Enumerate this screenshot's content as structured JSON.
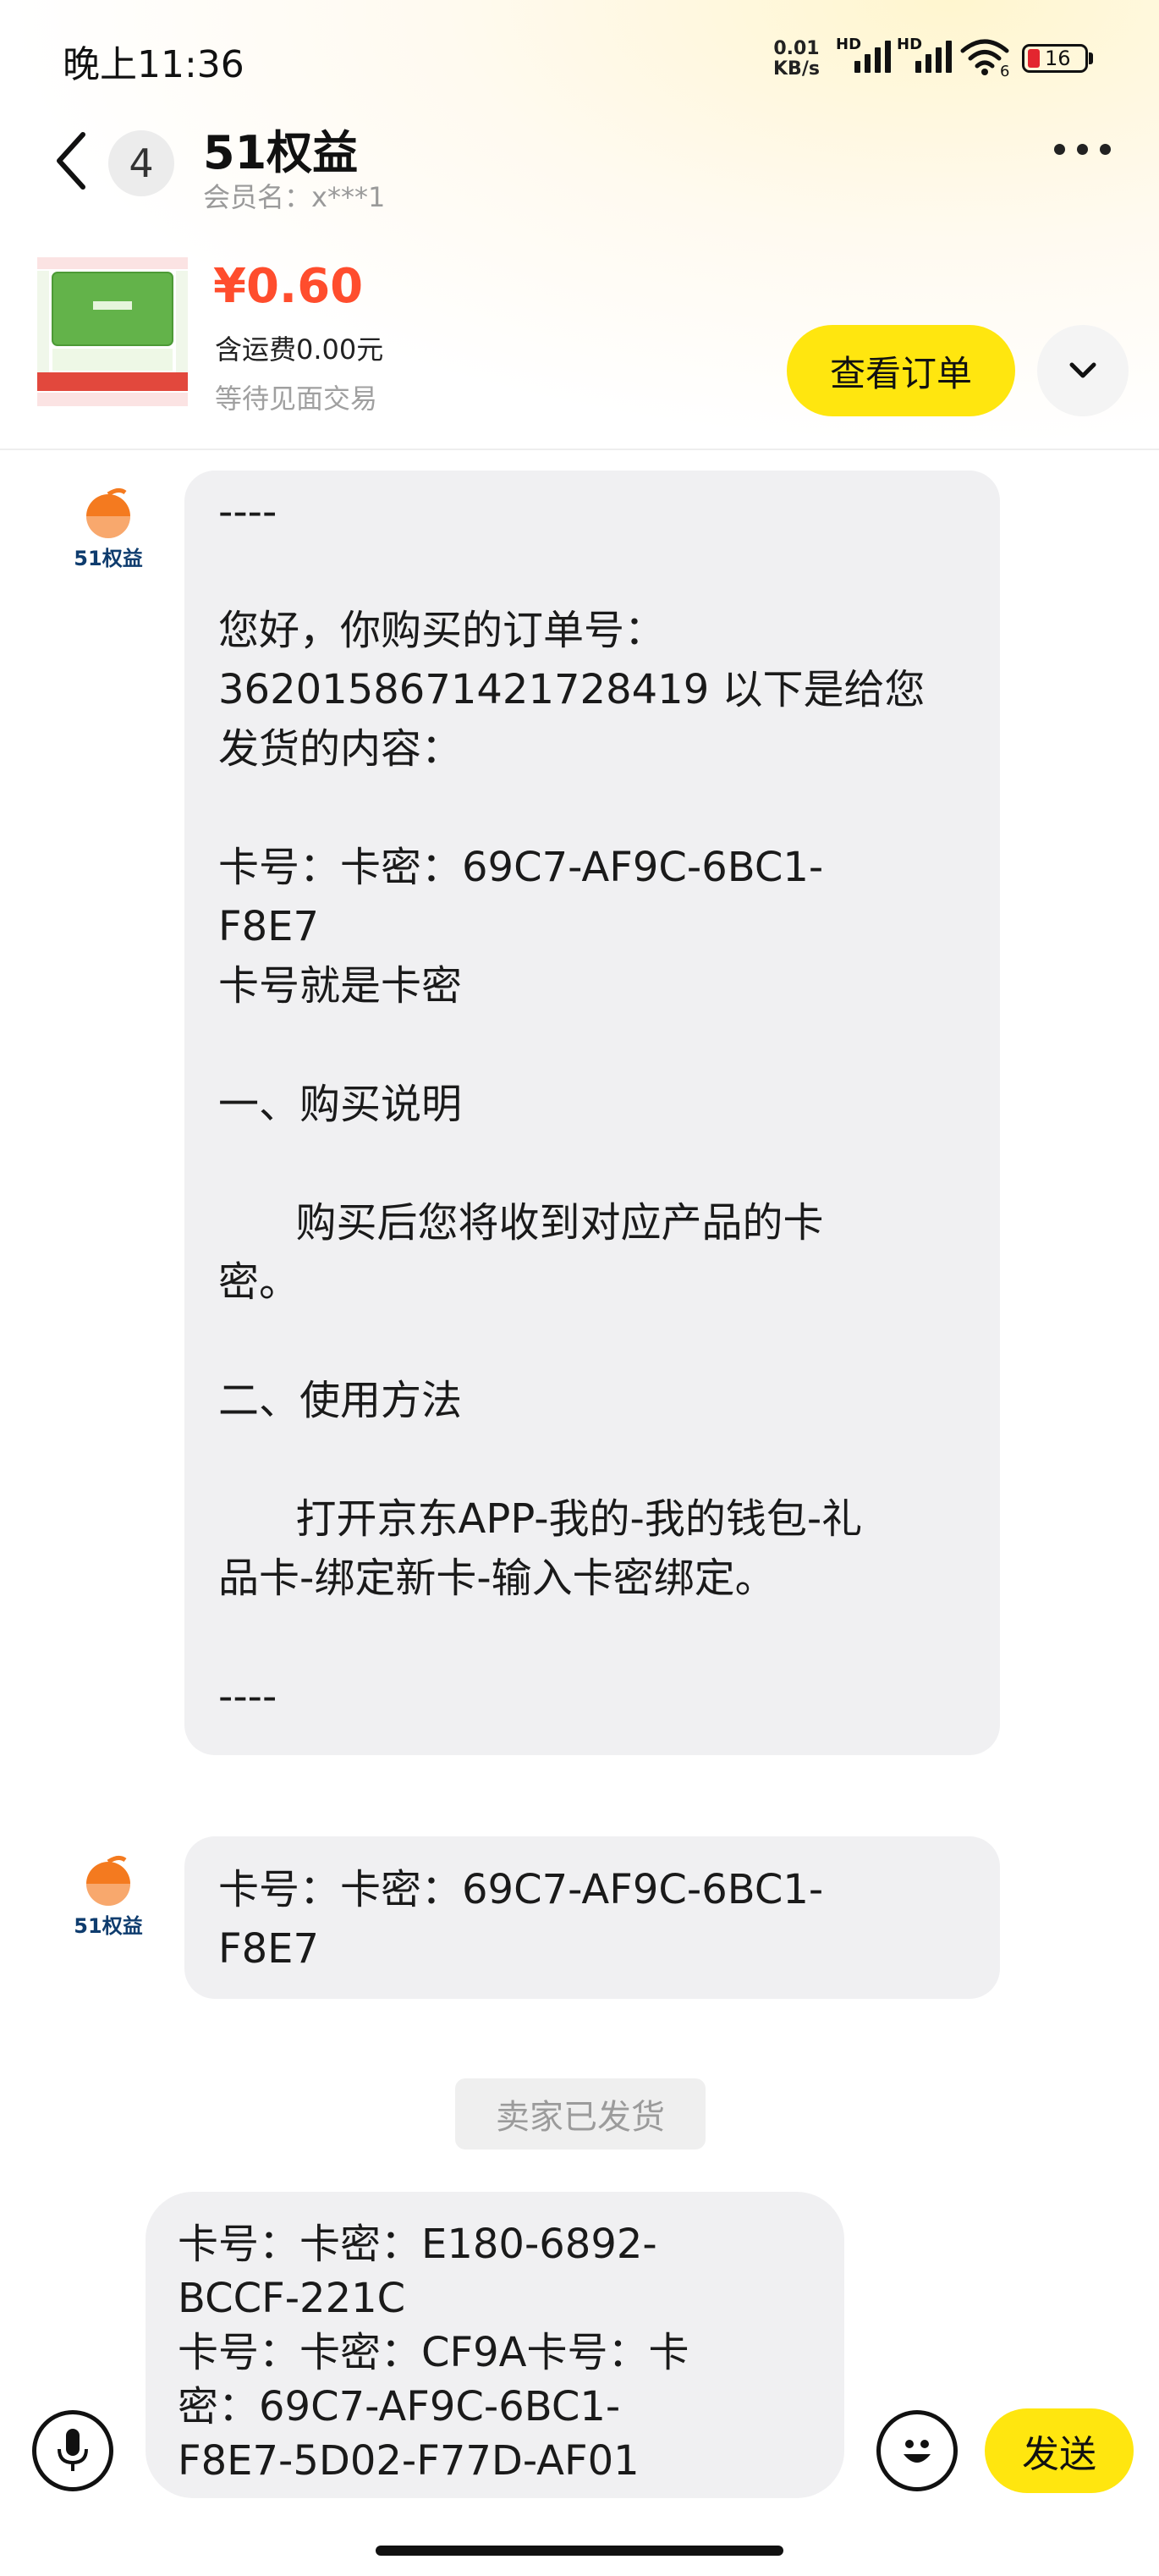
{
  "status_bar": {
    "time": "晚上11:36",
    "net_speed_value": "0.01",
    "net_speed_unit": "KB/s",
    "hd_label_1": "HD",
    "hd_label_2": "HD",
    "wifi_label": "6",
    "battery": "16"
  },
  "header": {
    "badge_count": "4",
    "shop_name": "51权益",
    "member_name": "会员名：x***1"
  },
  "product": {
    "price": "¥0.60",
    "shipping": "含运费0.00元",
    "status": "等待见面交易",
    "view_order_label": "查看订单"
  },
  "colors": {
    "accent_yellow": "#ffe60f",
    "price_red": "#ff4d2d",
    "bubble_gray": "#f0f0f2",
    "brand_orange": "#f47a1f"
  },
  "chat": {
    "avatar_label": "51权益",
    "message1_lines": [
      "----",
      "",
      "您好，你购买的订单号：",
      "3620158671421728419 以下是给您",
      "发货的内容：",
      "",
      "卡号：卡密：69C7-AF9C-6BC1-",
      "F8E7",
      "卡号就是卡密",
      "",
      "一、购买说明",
      "",
      "      购买后您将收到对应产品的卡",
      "密。",
      "",
      "二、使用方法",
      "",
      "      打开京东APP-我的-我的钱包-礼",
      "品卡-绑定新卡-输入卡密绑定。",
      "",
      "----"
    ],
    "message2_lines": [
      "卡号：卡密：69C7-AF9C-6BC1-",
      "F8E7"
    ],
    "system_notice": "卖家已发货"
  },
  "input": {
    "text": "卡号：卡密：E180-6892-\nBCCF-221C\n卡号：卡密：CF9A卡号：卡\n密：69C7-AF9C-6BC1-\nF8E7-5D02-F77D-AF01",
    "send_label": "发送"
  },
  "icons": {
    "back": "back-arrow-icon",
    "more": "more-icon",
    "expand": "chevron-down-icon",
    "mic": "mic-icon",
    "emoji": "emoji-icon"
  }
}
